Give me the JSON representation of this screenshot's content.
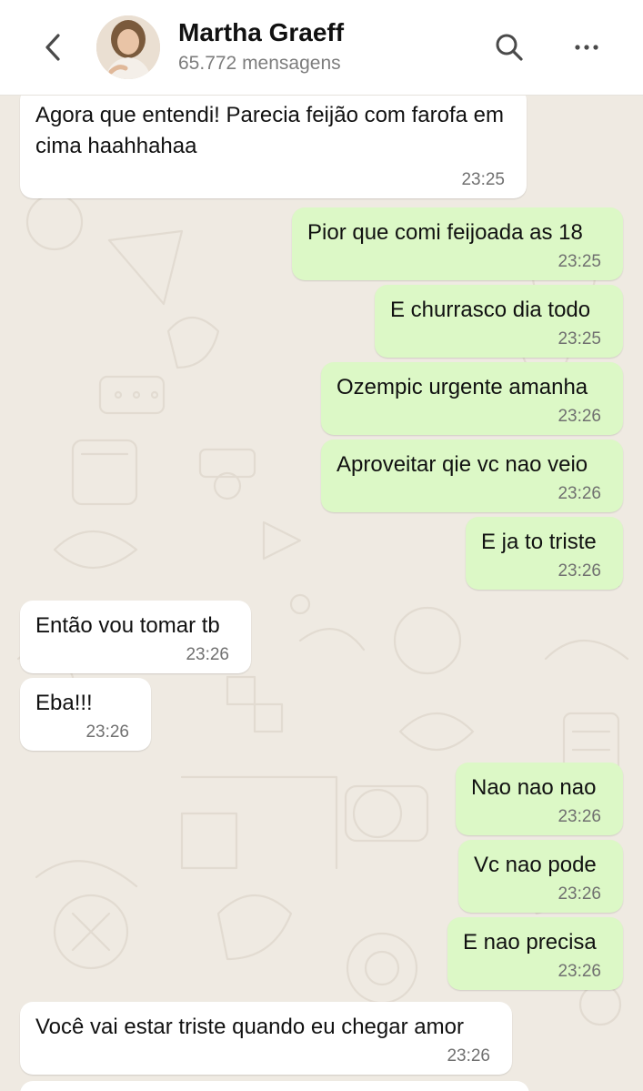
{
  "header": {
    "contact_name": "Martha Graeff",
    "message_count": "65.772 mensagens",
    "icons": {
      "back": "chevron-left-icon",
      "search": "search-icon",
      "more": "more-horizontal-icon"
    }
  },
  "colors": {
    "incoming_bubble": "#ffffff",
    "outgoing_bubble": "#dcf8c6",
    "wallpaper": "#efeae2",
    "timestamp": "#707070"
  },
  "messages": [
    {
      "direction": "incoming",
      "text": "Agora que entendi! Parecia feijão com farofa em cima haahhahaa",
      "time": "23:25"
    },
    {
      "direction": "outgoing",
      "text": "Pior que comi feijoada as 18",
      "time": "23:25"
    },
    {
      "direction": "outgoing",
      "text": "E churrasco dia todo",
      "time": "23:25"
    },
    {
      "direction": "outgoing",
      "text": "Ozempic urgente amanha",
      "time": "23:26"
    },
    {
      "direction": "outgoing",
      "text": "Aproveitar qie vc nao veio",
      "time": "23:26"
    },
    {
      "direction": "outgoing",
      "text": "E ja to triste",
      "time": "23:26"
    },
    {
      "direction": "incoming",
      "text": "Então vou tomar tb",
      "time": "23:26"
    },
    {
      "direction": "incoming",
      "text": "Eba!!!",
      "time": "23:26"
    },
    {
      "direction": "outgoing",
      "text": "Nao nao nao",
      "time": "23:26"
    },
    {
      "direction": "outgoing",
      "text": "Vc nao pode",
      "time": "23:26"
    },
    {
      "direction": "outgoing",
      "text": "E nao precisa",
      "time": "23:26"
    },
    {
      "direction": "incoming",
      "text": "Você vai estar triste quando eu chegar amor",
      "time": "23:26"
    }
  ]
}
